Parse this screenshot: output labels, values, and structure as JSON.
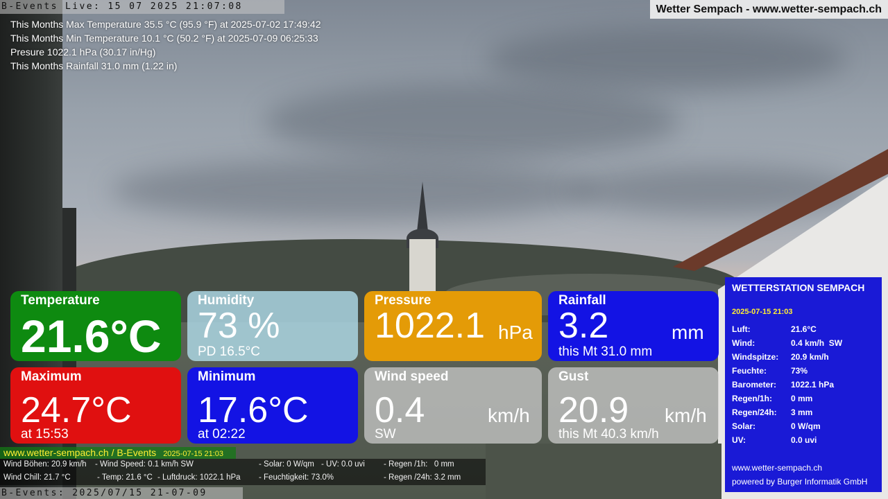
{
  "header": {
    "live_text": "B-Events Live: 15 07 2025 21:07:08",
    "site_title": "Wetter Sempach - www.wetter-sempach.ch"
  },
  "month_stats": [
    "This Months Max Temperature 35.5 °C (95.9 °F) at 2025-07-02 17:49:42",
    "This Months Min Temperature 10.1 °C (50.2 °F) at 2025-07-09 06:25:33",
    "Presure 1022.1 hPa (30.17 in/Hg)",
    "This Months Rainfall 31.0 mm (1.22 in)"
  ],
  "tiles": {
    "temperature": {
      "label": "Temperature",
      "value": "21.6°C",
      "color": "#0e8a10"
    },
    "humidity": {
      "label": "Humidity",
      "value": "73 %",
      "sub": "PD 16.5°C",
      "color": "#afdae8"
    },
    "pressure": {
      "label": "Pressure",
      "value": "1022.1",
      "unit": "hPa",
      "color": "#e49b07"
    },
    "rainfall": {
      "label": "Rainfall",
      "value": "3.2",
      "unit": "mm",
      "sub": "this Mt 31.0 mm",
      "color": "#1313e4"
    },
    "maximum": {
      "label": "Maximum",
      "value": "24.7°C",
      "sub": "at 15:53",
      "color": "#e01010"
    },
    "minimum": {
      "label": "Minimum",
      "value": "17.6°C",
      "sub": "at 02:22",
      "color": "#1313e4"
    },
    "wind_speed": {
      "label": "Wind speed",
      "value": "0.4",
      "unit": "km/h",
      "sub": "SW",
      "color": "#cecece"
    },
    "gust": {
      "label": "Gust",
      "value": "20.9",
      "unit": "km/h",
      "sub": "this Mt 40.3 km/h",
      "color": "#cecece"
    }
  },
  "ticker": {
    "site": "www.wetter-sempach.ch / B-Events",
    "date": "2025-07-15 21:03",
    "items": {
      "wind_gusts": "Wind Böhen: 20.9 km/h",
      "wind_speed": "- Wind Speed: 0.1 km/h SW",
      "solar": "- Solar: 0 W/qm",
      "uv": "- UV: 0.0 uvi",
      "rain_1h": "- Regen /1h:   0 mm",
      "wind_chill": "Wind Chill: 21.7 °C",
      "temp": "- Temp: 21.6 °C",
      "pressure": "- Luftdruck: 1022.1 hPa",
      "humidity": "- Feuchtigkeit: 73.0%",
      "rain_24h": "- Regen /24h: 3.2 mm"
    }
  },
  "bottom_timestamp": "B-Events: 2025/07/15 21-07-09",
  "station": {
    "title": "WETTERSTATION SEMPACH",
    "date": "2025-07-15 21:03",
    "rows": [
      {
        "key": "Luft:",
        "value": "21.6°C"
      },
      {
        "key": "Wind:",
        "value": "0.4 km/h  SW"
      },
      {
        "key": "Windspitze:",
        "value": "20.9 km/h"
      },
      {
        "key": "Feuchte:",
        "value": "73%"
      },
      {
        "key": "Barometer:",
        "value": "1022.1 hPa"
      },
      {
        "key": "Regen/1h:",
        "value": "0 mm"
      },
      {
        "key": "Regen/24h:",
        "value": "3 mm"
      },
      {
        "key": "Solar:",
        "value": "0 W/qm"
      },
      {
        "key": "UV:",
        "value": "0.0 uvi"
      }
    ],
    "url": "www.wetter-sempach.ch",
    "powered_by": "powered by Burger Informatik GmbH"
  }
}
